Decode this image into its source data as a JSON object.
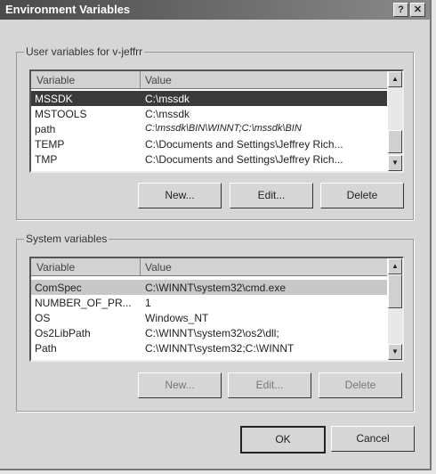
{
  "window": {
    "title": "Environment Variables",
    "help": "?",
    "close": "✕"
  },
  "user": {
    "label": "User variables for v-jeffrr",
    "columns": [
      "Variable",
      "Value"
    ],
    "rows": [
      {
        "name": "MSSDK",
        "value": "C:\\mssdk"
      },
      {
        "name": "MSTOOLS",
        "value": "C:\\mssdk"
      },
      {
        "name": "path",
        "value": "C:\\mssdk\\BIN\\WINNT;C:\\mssdk\\BIN"
      },
      {
        "name": "TEMP",
        "value": "C:\\Documents and Settings\\Jeffrey Rich..."
      },
      {
        "name": "TMP",
        "value": "C:\\Documents and Settings\\Jeffrey Rich..."
      }
    ],
    "selected": "MSSDK",
    "new": "New...",
    "edit": "Edit...",
    "delete": "Delete"
  },
  "system": {
    "label": "System variables",
    "columns": [
      "Variable",
      "Value"
    ],
    "rows": [
      {
        "name": "ComSpec",
        "value": "C:\\WINNT\\system32\\cmd.exe"
      },
      {
        "name": "NUMBER_OF_PR...",
        "value": "1"
      },
      {
        "name": "OS",
        "value": "Windows_NT"
      },
      {
        "name": "Os2LibPath",
        "value": "C:\\WINNT\\system32\\os2\\dll;"
      },
      {
        "name": "Path",
        "value": "C:\\WINNT\\system32;C:\\WINNT"
      }
    ],
    "selected": "ComSpec",
    "new": "New...",
    "edit": "Edit...",
    "delete": "Delete"
  },
  "ok": "OK",
  "cancel": "Cancel"
}
